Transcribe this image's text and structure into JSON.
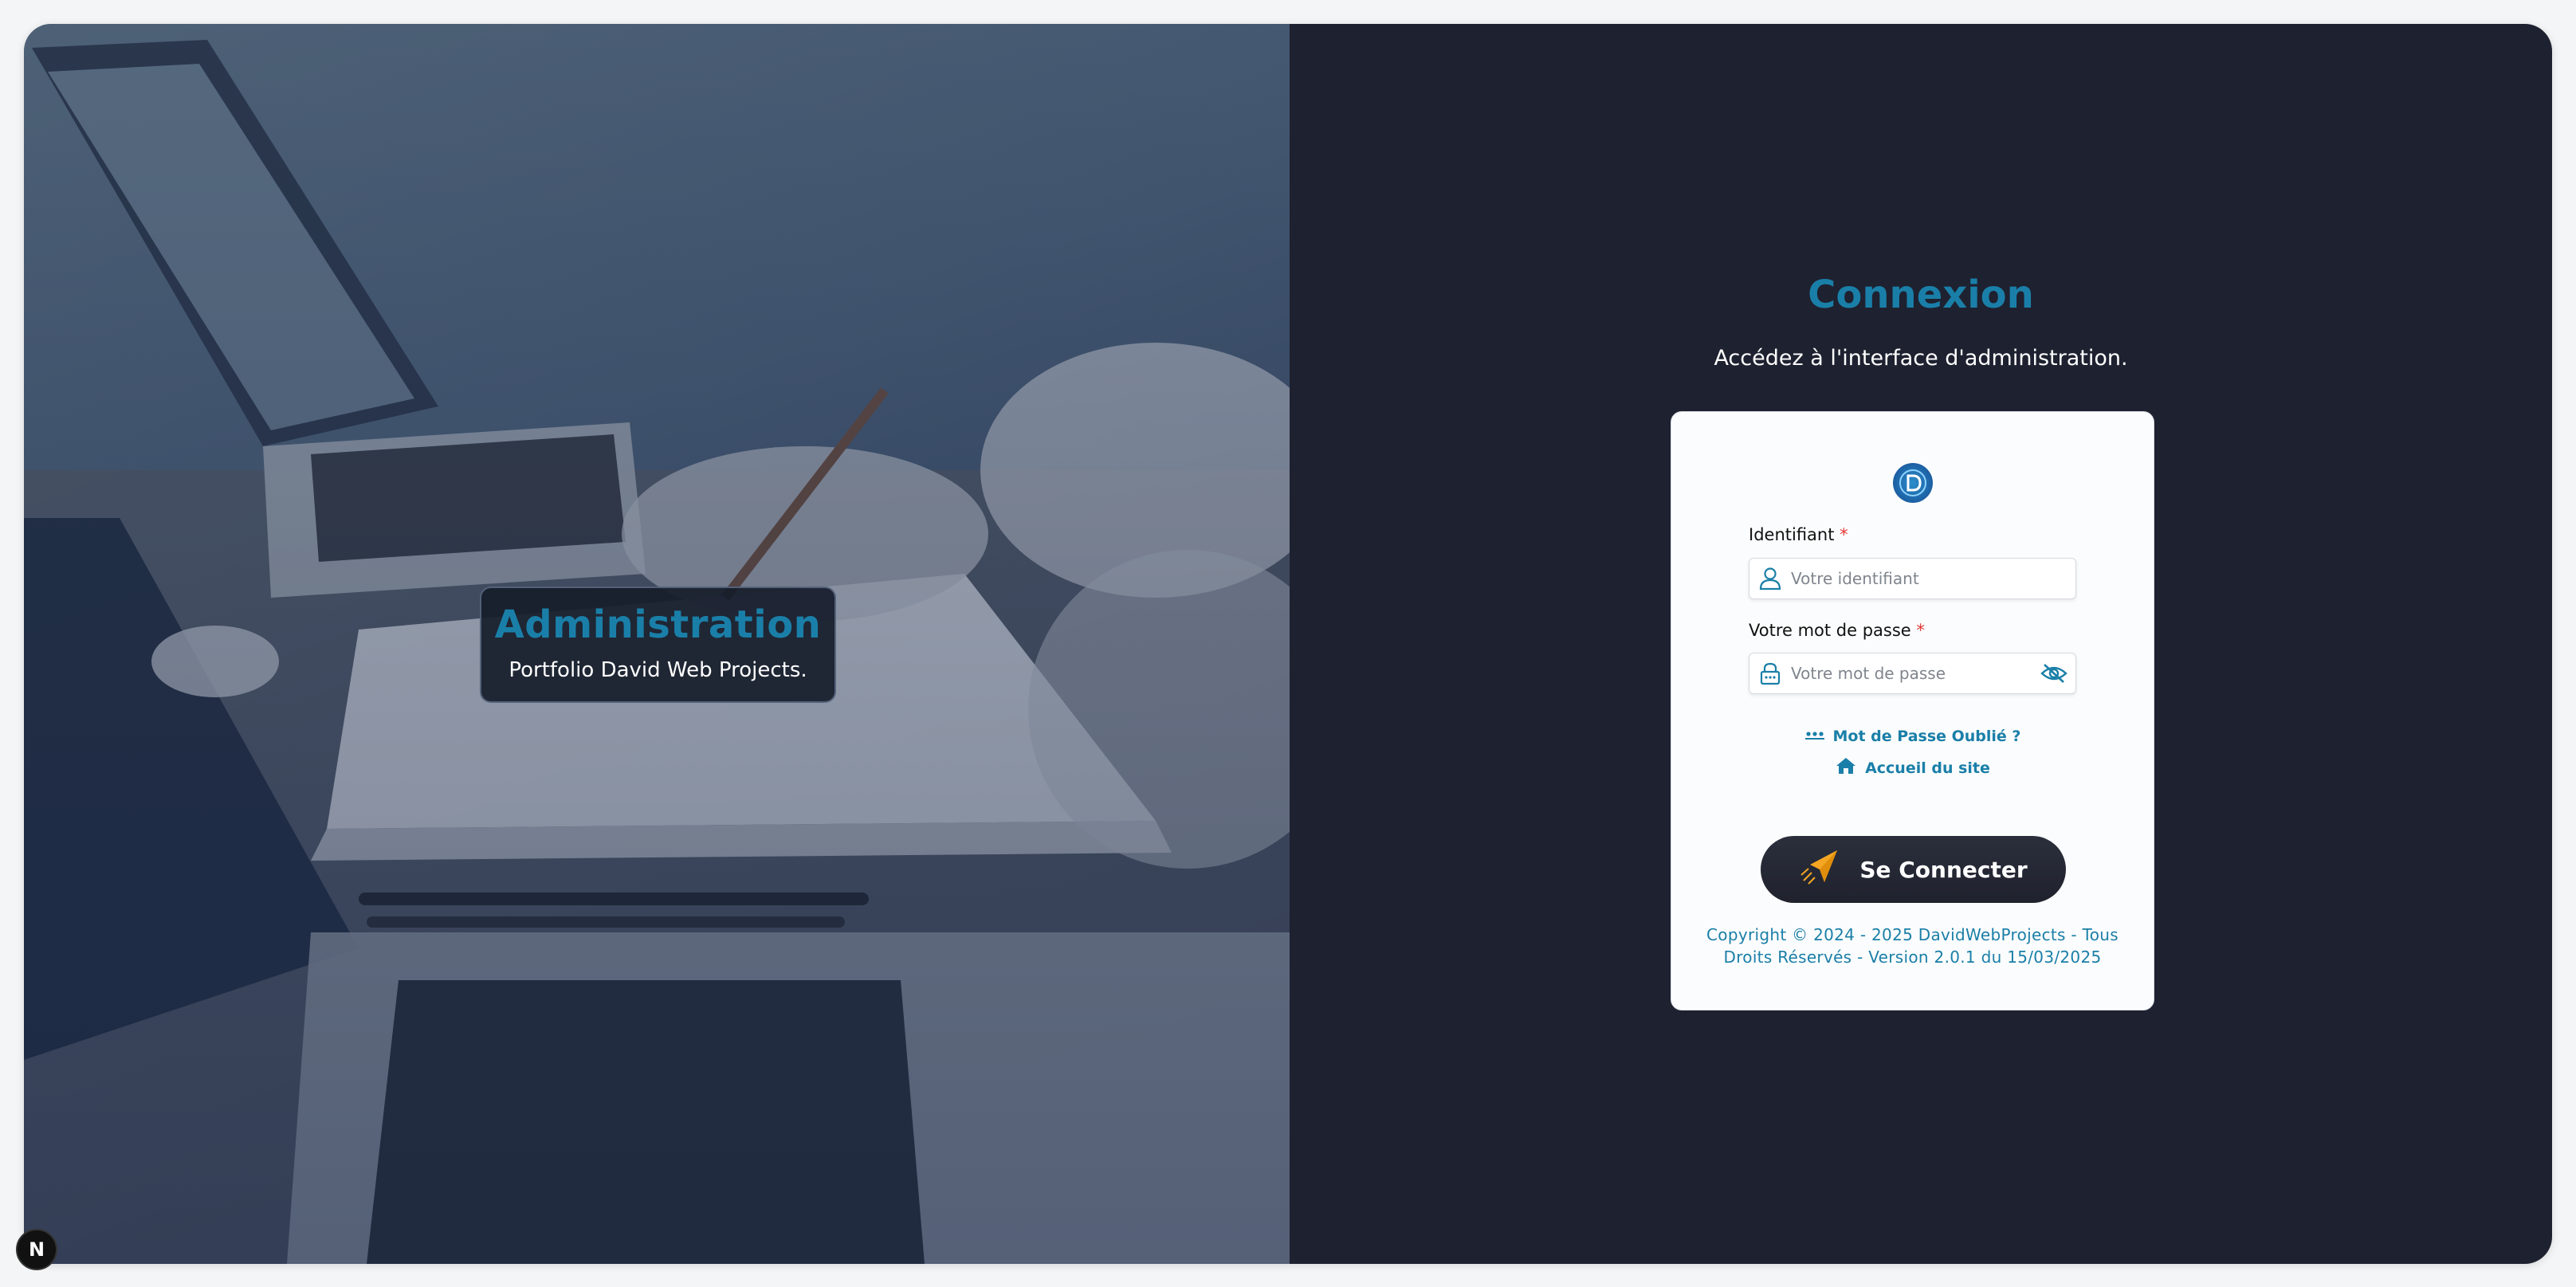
{
  "left_panel": {
    "title": "Administration",
    "subtitle": "Portfolio David Web Projects."
  },
  "right_panel": {
    "title": "Connexion",
    "subtitle": "Accédez à l'interface d'administration."
  },
  "form": {
    "logo_icon": "logo-d-icon",
    "username": {
      "label": "Identifiant",
      "required_mark": "*",
      "placeholder": "Votre identifiant",
      "value": ""
    },
    "password": {
      "label": "Votre mot de passe",
      "required_mark": "*",
      "placeholder": "Votre mot de passe",
      "value": ""
    },
    "forgot_link": "Mot de Passe Oublié ?",
    "home_link": "Accueil du site",
    "submit_label": "Se Connecter",
    "copyright_line1": "Copyright © 2024 - 2025 DavidWebProjects - Tous",
    "copyright_line2": "Droits Réservés - Version 2.0.1 du 15/03/2025"
  },
  "badge": {
    "label": "N"
  },
  "colors": {
    "accent": "#1a7fa8",
    "dark_bg": "#1e2130",
    "button_icon": "#f5a623",
    "required": "#e53935"
  }
}
